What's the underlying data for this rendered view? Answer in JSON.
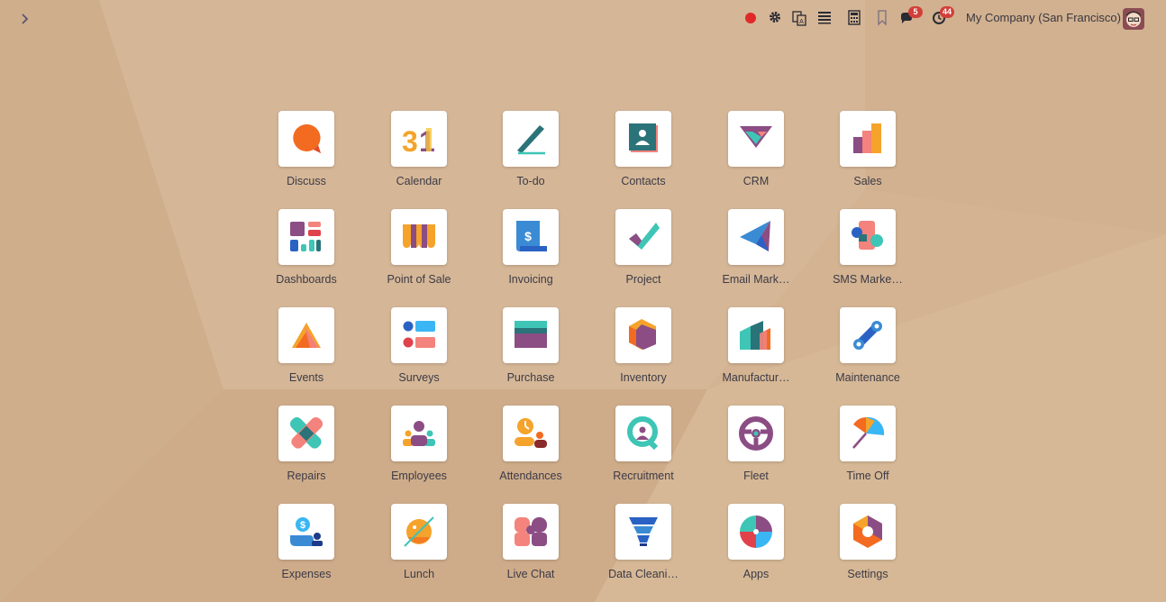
{
  "systray": {
    "company": "My Company (San Francisco)",
    "messages_badge": "5",
    "activities_badge": "44",
    "icons": [
      "recording-dot-icon",
      "settings-gear-icon",
      "translate-icon",
      "list-icon",
      "calculator-icon",
      "bookmark-icon",
      "chat-icon",
      "clock-icon"
    ]
  },
  "apps": [
    {
      "label": "Discuss",
      "icon": "discuss-icon"
    },
    {
      "label": "Calendar",
      "icon": "calendar-icon"
    },
    {
      "label": "To-do",
      "icon": "todo-icon"
    },
    {
      "label": "Contacts",
      "icon": "contacts-icon"
    },
    {
      "label": "CRM",
      "icon": "crm-icon"
    },
    {
      "label": "Sales",
      "icon": "sales-icon"
    },
    {
      "label": "Dashboards",
      "icon": "dashboards-icon"
    },
    {
      "label": "Point of Sale",
      "icon": "point-of-sale-icon"
    },
    {
      "label": "Invoicing",
      "icon": "invoicing-icon"
    },
    {
      "label": "Project",
      "icon": "project-icon"
    },
    {
      "label": "Email Mark…",
      "icon": "email-marketing-icon"
    },
    {
      "label": "SMS Marke…",
      "icon": "sms-marketing-icon"
    },
    {
      "label": "Events",
      "icon": "events-icon"
    },
    {
      "label": "Surveys",
      "icon": "surveys-icon"
    },
    {
      "label": "Purchase",
      "icon": "purchase-icon"
    },
    {
      "label": "Inventory",
      "icon": "inventory-icon"
    },
    {
      "label": "Manufactur…",
      "icon": "manufacturing-icon"
    },
    {
      "label": "Maintenance",
      "icon": "maintenance-icon"
    },
    {
      "label": "Repairs",
      "icon": "repairs-icon"
    },
    {
      "label": "Employees",
      "icon": "employees-icon"
    },
    {
      "label": "Attendances",
      "icon": "attendances-icon"
    },
    {
      "label": "Recruitment",
      "icon": "recruitment-icon"
    },
    {
      "label": "Fleet",
      "icon": "fleet-icon"
    },
    {
      "label": "Time Off",
      "icon": "time-off-icon"
    },
    {
      "label": "Expenses",
      "icon": "expenses-icon"
    },
    {
      "label": "Lunch",
      "icon": "lunch-icon"
    },
    {
      "label": "Live Chat",
      "icon": "live-chat-icon"
    },
    {
      "label": "Data Cleani…",
      "icon": "data-cleaning-icon"
    },
    {
      "label": "Apps",
      "icon": "apps-icon"
    },
    {
      "label": "Settings",
      "icon": "settings-icon"
    }
  ]
}
